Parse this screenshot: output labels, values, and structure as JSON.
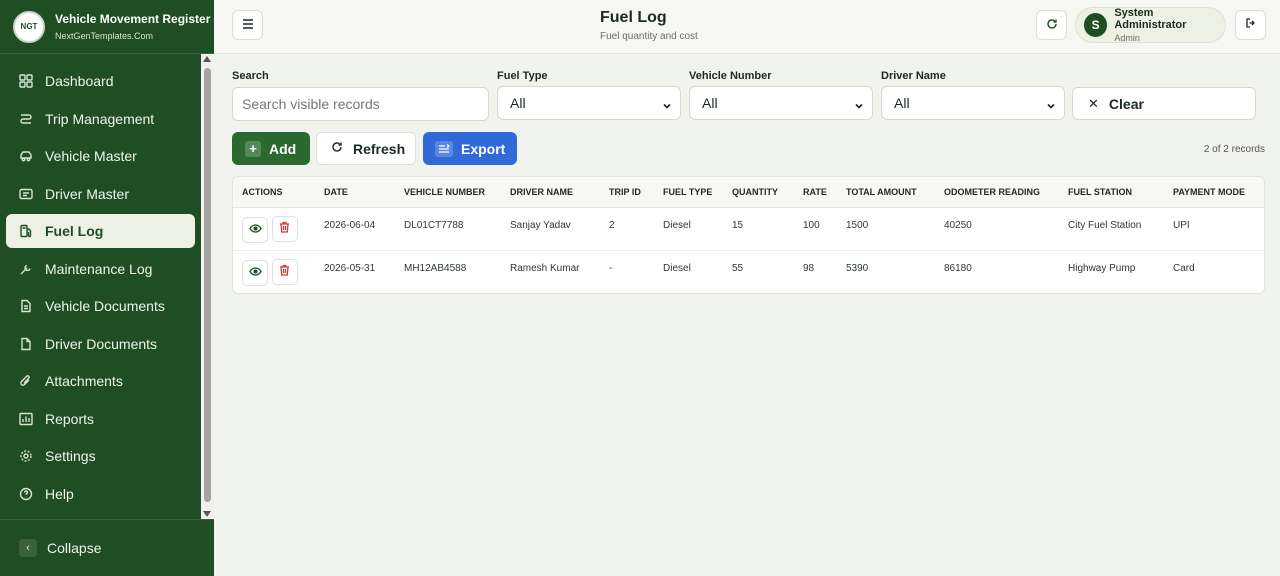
{
  "brand": {
    "title": "Vehicle Movement Register",
    "subtitle": "NextGenTemplates.Com",
    "logo_text": "NGT"
  },
  "sidebar": {
    "items": [
      {
        "label": "Dashboard",
        "icon": "dashboard-icon"
      },
      {
        "label": "Trip Management",
        "icon": "route-icon"
      },
      {
        "label": "Vehicle Master",
        "icon": "car-icon"
      },
      {
        "label": "Driver Master",
        "icon": "id-card-icon"
      },
      {
        "label": "Fuel Log",
        "icon": "fuel-icon",
        "active": true
      },
      {
        "label": "Maintenance Log",
        "icon": "wrench-icon"
      },
      {
        "label": "Vehicle Documents",
        "icon": "document-icon"
      },
      {
        "label": "Driver Documents",
        "icon": "file-icon"
      },
      {
        "label": "Attachments",
        "icon": "paperclip-icon"
      },
      {
        "label": "Reports",
        "icon": "bar-chart-icon"
      },
      {
        "label": "Settings",
        "icon": "gear-icon"
      },
      {
        "label": "Help",
        "icon": "help-icon"
      }
    ],
    "collapse_label": "Collapse"
  },
  "header": {
    "title": "Fuel Log",
    "subtitle": "Fuel quantity and cost",
    "user": {
      "initial": "S",
      "name": "System Administrator",
      "role": "Admin"
    }
  },
  "filters": {
    "search": {
      "label": "Search",
      "placeholder": "Search visible records",
      "value": ""
    },
    "fuel_type": {
      "label": "Fuel Type",
      "value": "All"
    },
    "vehicle_number": {
      "label": "Vehicle Number",
      "value": "All"
    },
    "driver_name": {
      "label": "Driver Name",
      "value": "All"
    },
    "clear_label": "Clear"
  },
  "toolbar": {
    "add_label": "Add",
    "refresh_label": "Refresh",
    "export_label": "Export",
    "record_count": "2 of 2 records"
  },
  "table": {
    "columns": [
      "Actions",
      "Date",
      "Vehicle Number",
      "Driver Name",
      "Trip ID",
      "Fuel Type",
      "Quantity",
      "Rate",
      "Total Amount",
      "Odometer Reading",
      "Fuel Station",
      "Payment Mode"
    ],
    "rows": [
      {
        "date": "2026-06-04",
        "vehicle": "DL01CT7788",
        "driver": "Sanjay Yadav",
        "trip": "2",
        "fuel": "Diesel",
        "qty": "15",
        "rate": "100",
        "total": "1500",
        "odometer": "40250",
        "station": "City Fuel Station",
        "payment": "UPI"
      },
      {
        "date": "2026-05-31",
        "vehicle": "MH12AB4588",
        "driver": "Ramesh Kumar",
        "trip": "-",
        "fuel": "Diesel",
        "qty": "55",
        "rate": "98",
        "total": "5390",
        "odometer": "86180",
        "station": "Highway Pump",
        "payment": "Card"
      }
    ]
  },
  "colors": {
    "sidebar": "#1f4d24",
    "primary": "#2b6a2f",
    "export": "#3169d8",
    "delete": "#d33a3a"
  }
}
